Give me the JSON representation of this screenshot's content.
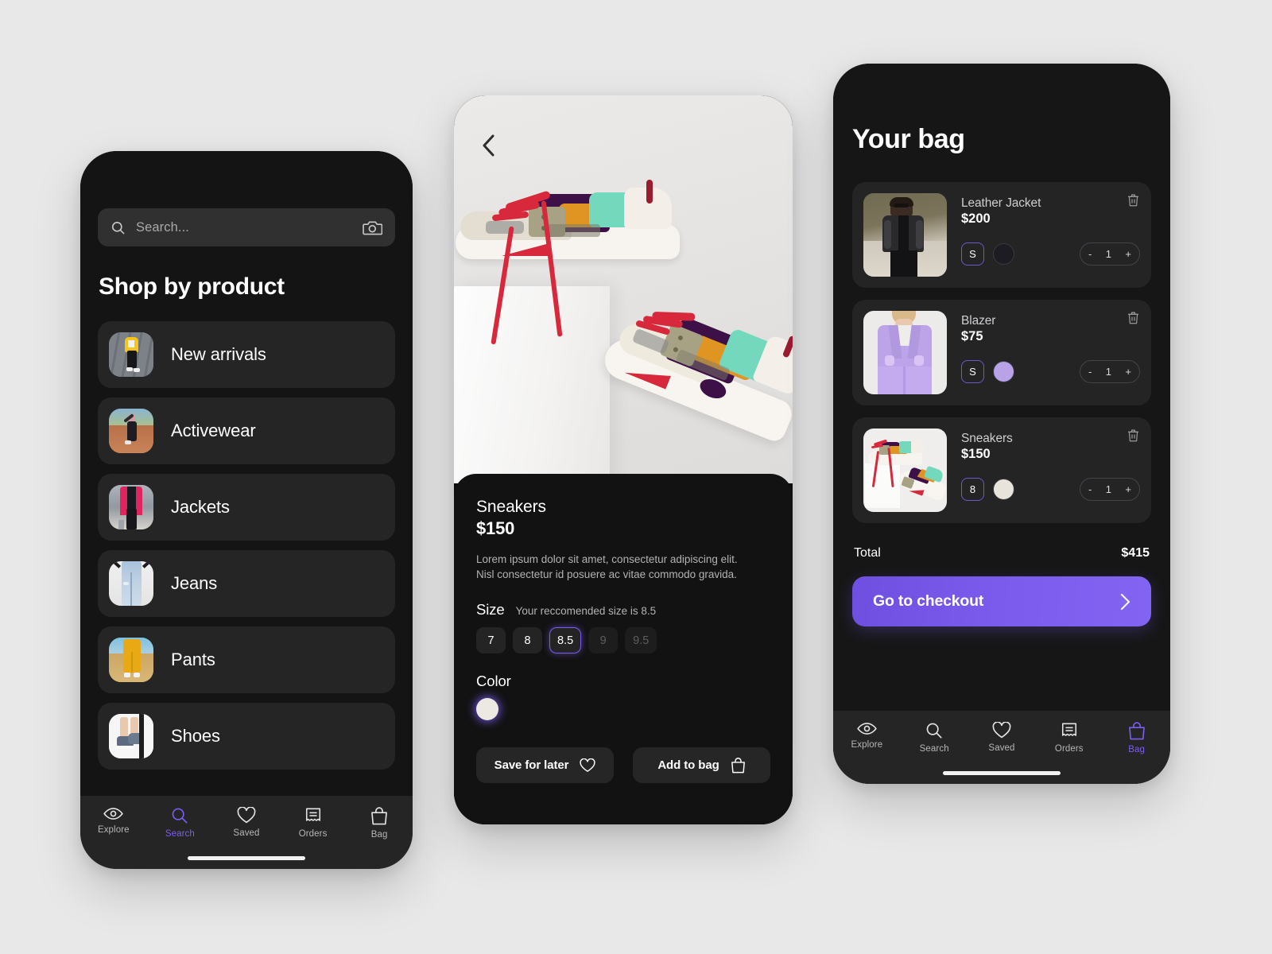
{
  "screens": {
    "search": {
      "search_input": {
        "value": "",
        "placeholder": "Search..."
      },
      "title": "Shop by product",
      "categories": [
        {
          "label": "New arrivals"
        },
        {
          "label": "Activewear"
        },
        {
          "label": "Jackets"
        },
        {
          "label": "Jeans"
        },
        {
          "label": "Pants"
        },
        {
          "label": "Shoes"
        }
      ],
      "tabs": [
        {
          "label": "Explore",
          "icon": "eye-icon",
          "active": false
        },
        {
          "label": "Search",
          "icon": "search-icon",
          "active": true
        },
        {
          "label": "Saved",
          "icon": "heart-icon",
          "active": false
        },
        {
          "label": "Orders",
          "icon": "receipt-icon",
          "active": false
        },
        {
          "label": "Bag",
          "icon": "bag-icon",
          "active": false
        }
      ]
    },
    "product": {
      "name": "Sneakers",
      "price": "$150",
      "description": "Lorem ipsum dolor sit amet, consectetur adipiscing elit. Nisl consectetur id posuere ac vitae commodo gravida.",
      "size_section_title": "Size",
      "size_hint": "Your reccomended size is 8.5",
      "sizes": [
        {
          "label": "7",
          "state": "available"
        },
        {
          "label": "8",
          "state": "available"
        },
        {
          "label": "8.5",
          "state": "selected"
        },
        {
          "label": "9",
          "state": "disabled"
        },
        {
          "label": "9.5",
          "state": "disabled"
        }
      ],
      "color_section_title": "Color",
      "colors": [
        {
          "hex": "#ece9e3",
          "selected": true
        }
      ],
      "save_label": "Save for later",
      "add_label": "Add to bag"
    },
    "bag": {
      "title": "Your bag",
      "items": [
        {
          "name": "Leather Jacket",
          "price": "$200",
          "size": "S",
          "color_hex": "#1c1c22",
          "qty": "1",
          "minus": "-",
          "plus": "+"
        },
        {
          "name": "Blazer",
          "price": "$75",
          "size": "S",
          "color_hex": "#b9a3e8",
          "qty": "1",
          "minus": "-",
          "plus": "+"
        },
        {
          "name": "Sneakers",
          "price": "$150",
          "size": "8",
          "color_hex": "#e8e4dc",
          "qty": "1",
          "minus": "-",
          "plus": "+"
        }
      ],
      "total_label": "Total",
      "total_value": "$415",
      "checkout_label": "Go to checkout",
      "tabs": [
        {
          "label": "Explore",
          "icon": "eye-icon",
          "active": false
        },
        {
          "label": "Search",
          "icon": "search-icon",
          "active": false
        },
        {
          "label": "Saved",
          "icon": "heart-icon",
          "active": false
        },
        {
          "label": "Orders",
          "icon": "receipt-icon",
          "active": false
        },
        {
          "label": "Bag",
          "icon": "bag-icon",
          "active": true
        }
      ]
    }
  },
  "theme": {
    "accent": "#7d5cf0",
    "background": "#e8e8e9",
    "surface": "#242425",
    "screen_bg": "#141414"
  }
}
